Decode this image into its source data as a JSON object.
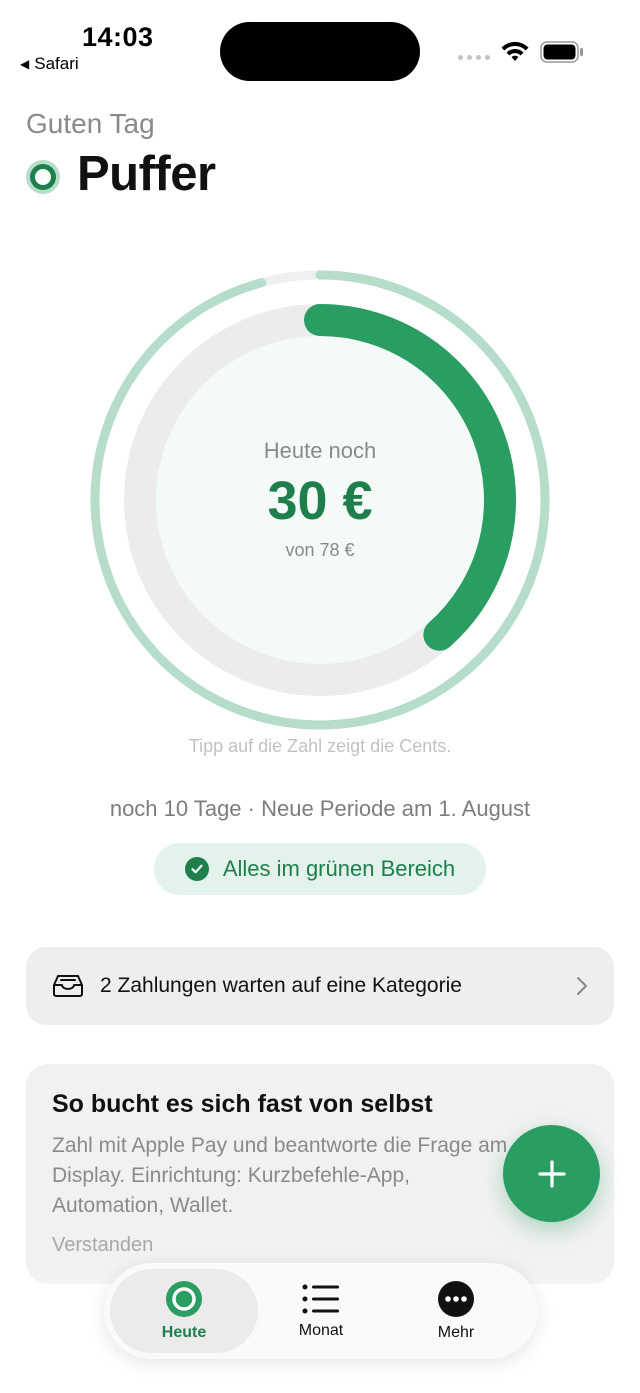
{
  "status_bar": {
    "time": "14:03",
    "back_app": "Safari"
  },
  "header": {
    "greeting": "Guten Tag",
    "app_name": "Puffer"
  },
  "budget_ring": {
    "label": "Heute noch",
    "remaining": "30 €",
    "total": "von 78 €",
    "remaining_value": 30,
    "total_value": 78
  },
  "tip": "Tipp auf die Zahl zeigt die Cents.",
  "period": "noch 10 Tage · Neue Periode am 1. August",
  "status_pill": "Alles im grünen Bereich",
  "pending_card": {
    "text": "2 Zahlungen warten auf eine Kategorie",
    "icon": "tray-icon"
  },
  "info_card": {
    "title": "So bucht es sich fast von selbst",
    "body": "Zahl mit Apple Pay und beantworte die Frage am Display. Einrichtung: Kurzbefehle-App, Automation, Wallet.",
    "dismiss": "Verstanden"
  },
  "tabs": [
    {
      "label": "Heute",
      "icon": "ring-icon",
      "active": true
    },
    {
      "label": "Monat",
      "icon": "list-icon",
      "active": false
    },
    {
      "label": "Mehr",
      "icon": "more-icon",
      "active": false
    }
  ],
  "colors": {
    "accent": "#1f7f4c",
    "accent_bright": "#2a9d62",
    "accent_light": "#b5ddc9",
    "pill_bg": "#e3f2ea"
  }
}
